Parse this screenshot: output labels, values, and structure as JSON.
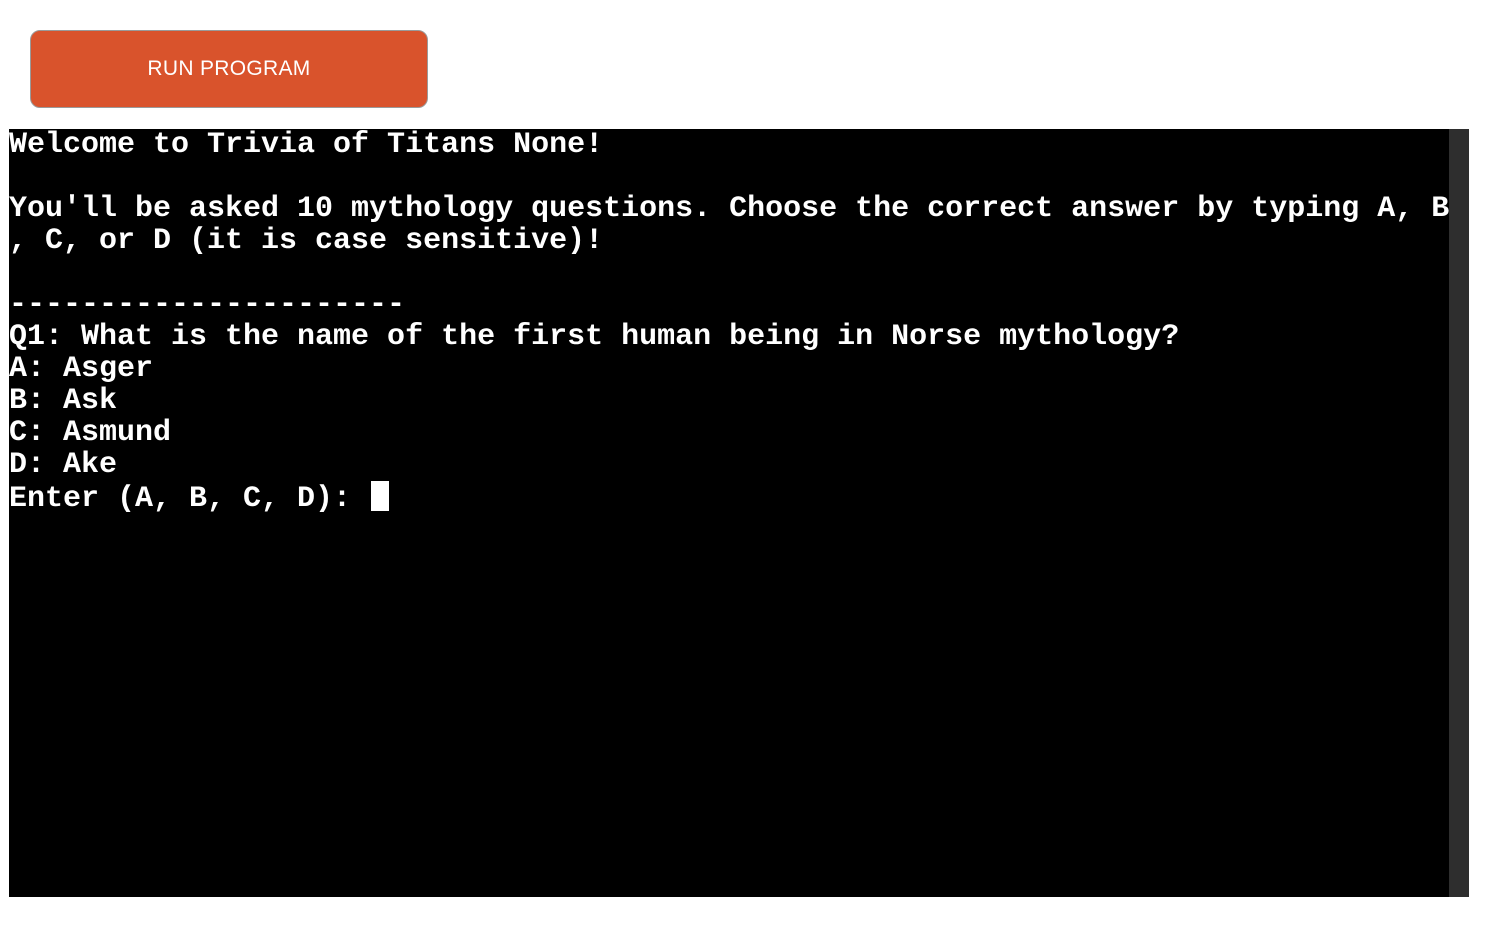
{
  "toolbar": {
    "run_label": "RUN PROGRAM"
  },
  "terminal": {
    "lines": [
      "Welcome to Trivia of Titans None!",
      "",
      "You'll be asked 10 mythology questions. Choose the correct answer by typing A, B",
      ", C, or D (it is case sensitive)!",
      "",
      "----------------------",
      "Q1: What is the name of the first human being in Norse mythology?",
      "A: Asger",
      "B: Ask",
      "C: Asmund",
      "D: Ake"
    ],
    "prompt": "Enter (A, B, C, D): "
  },
  "colors": {
    "button_bg": "#d9532c",
    "terminal_bg": "#000000",
    "terminal_fg": "#ffffff",
    "scrollbar": "#2e2e2e"
  }
}
